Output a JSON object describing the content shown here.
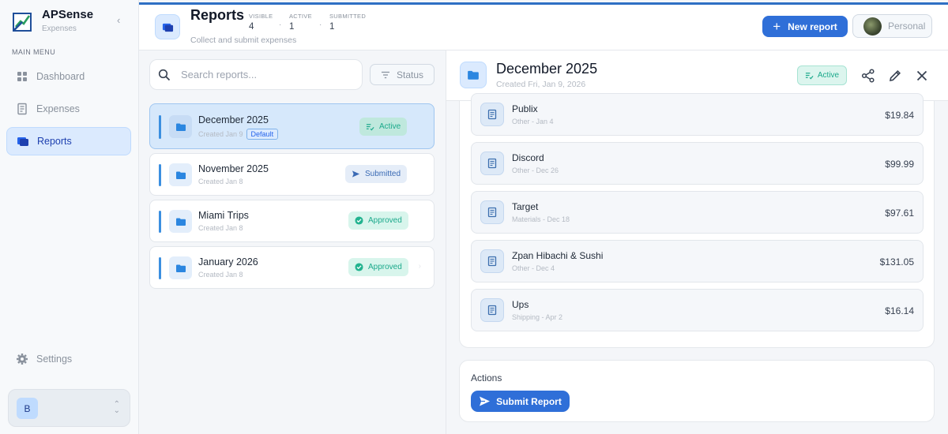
{
  "brand": {
    "name": "APSense",
    "subtitle": "Expenses"
  },
  "sidebar": {
    "section_label": "MAIN MENU",
    "items": [
      {
        "label": "Dashboard",
        "icon": "dashboard-icon",
        "active": false
      },
      {
        "label": "Expenses",
        "icon": "receipt-icon",
        "active": false
      },
      {
        "label": "Reports",
        "icon": "folders-icon",
        "active": true
      }
    ],
    "settings_label": "Settings",
    "user_initial": "B"
  },
  "header": {
    "title": "Reports",
    "subtitle": "Collect and submit expenses",
    "stats": [
      {
        "label": "VISIBLE",
        "value": "4"
      },
      {
        "label": "ACTIVE",
        "value": "1"
      },
      {
        "label": "SUBMITTED",
        "value": "1"
      }
    ],
    "new_report_label": "New report",
    "personal_label": "Personal"
  },
  "list": {
    "search_placeholder": "Search reports...",
    "status_filter_label": "Status",
    "default_badge": "Default",
    "reports": [
      {
        "title": "December 2025",
        "created": "Created Jan 9",
        "status": "Active",
        "status_kind": "active",
        "default": true,
        "selected": true
      },
      {
        "title": "November 2025",
        "created": "Created Jan 8",
        "status": "Submitted",
        "status_kind": "submitted",
        "default": false,
        "selected": false
      },
      {
        "title": "Miami Trips",
        "created": "Created Jan 8",
        "status": "Approved",
        "status_kind": "approved",
        "default": false,
        "selected": false
      },
      {
        "title": "January 2026",
        "created": "Created Jan 8",
        "status": "Approved",
        "status_kind": "approved",
        "default": false,
        "selected": false
      }
    ]
  },
  "detail": {
    "title": "December 2025",
    "created": "Created Fri, Jan 9, 2026",
    "status": "Active",
    "expenses": [
      {
        "name": "Publix",
        "meta": "Other - Jan 4",
        "amount": "$19.84"
      },
      {
        "name": "Discord",
        "meta": "Other - Dec 26",
        "amount": "$99.99"
      },
      {
        "name": "Target",
        "meta": "Materials - Dec 18",
        "amount": "$97.61"
      },
      {
        "name": "Zpan Hibachi & Sushi",
        "meta": "Other - Dec 4",
        "amount": "$131.05"
      },
      {
        "name": "Ups",
        "meta": "Shipping - Apr 2",
        "amount": "$16.14"
      }
    ],
    "actions_title": "Actions",
    "submit_label": "Submit Report"
  },
  "colors": {
    "accent": "#2f6fd8",
    "active_green": "#1ba98b",
    "selected_bg": "#d6e8fb"
  }
}
